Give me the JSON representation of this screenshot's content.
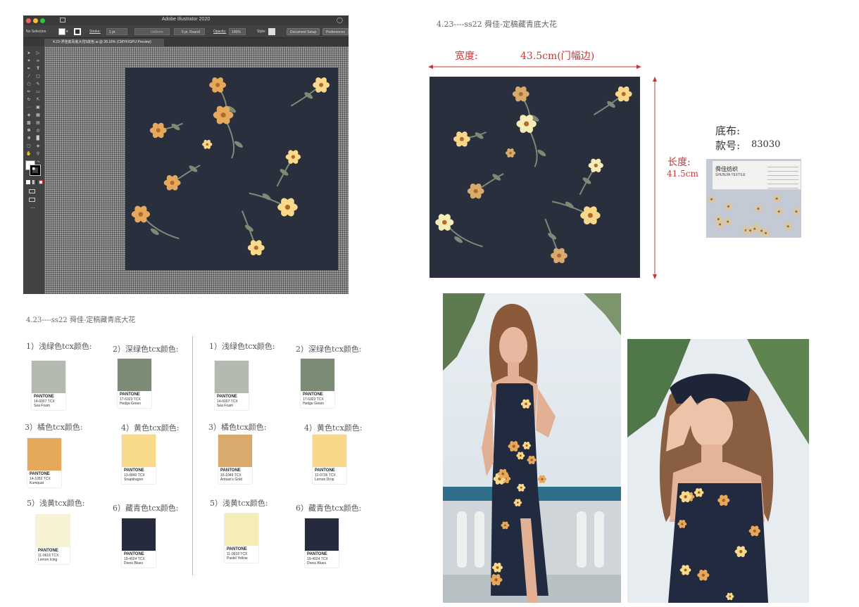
{
  "illustrator": {
    "app_title": "Adobe Illustrator 2020",
    "selection": "No Selection",
    "stroke_label": "Stroke:",
    "stroke_value": "1 pt",
    "uniform": "Uniform",
    "brush": "5 pt. Round",
    "opacity_label": "Opacity:",
    "opacity_value": "100%",
    "style_label": "Style:",
    "document_setup": "Document Setup",
    "preferences": "Preferences",
    "doc_tab": "4.23-浮佳底青底大花5底色.ai @ 28.18% (CMYK/GPU Preview)"
  },
  "header": {
    "title_right": "4.23----ss22 舜佳-定稿藏青底大花",
    "title_left": "4.23----ss22 舜佳-定稿藏青底大花"
  },
  "dimensions": {
    "width_label": "宽度:",
    "width_value": "43.5cm(门幅边)",
    "length_label": "长度:",
    "length_value": "41.5cm"
  },
  "fabric": {
    "base_label": "底布:",
    "code_label": "款号:",
    "code_value": "83030",
    "tag_brand": "舜佳纺织",
    "tag_brand_en": "SHUNJIA TEXTILE"
  },
  "palette_left": [
    {
      "label": "1）浅绿色tcx颜色:",
      "brand": "PANTONE",
      "code": "14-6007 TCX",
      "name": "Sea Foam",
      "color": "#b2b9af"
    },
    {
      "label": "2）深绿色tcx颜色:",
      "brand": "PANTONE",
      "code": "17-6323 TCX",
      "name": "Hedge Green",
      "color": "#7c8b76"
    },
    {
      "label": "3）橘色tcx颜色:",
      "brand": "PANTONE",
      "code": "14-1052 TCX",
      "name": "Kumquat",
      "color": "#e6a85a"
    },
    {
      "label": "4）黄色tcx颜色:",
      "brand": "PANTONE",
      "code": "13-0840 TCX",
      "name": "Snapdragon",
      "color": "#f9d98a"
    },
    {
      "label": "5）浅黄tcx颜色:",
      "brand": "PANTONE",
      "code": "11-0616 TCX",
      "name": "Lemon Icing",
      "color": "#f7f3d2"
    },
    {
      "label": "6）藏青色tcx颜色:",
      "brand": "PANTONE",
      "code": "19-4024 TCX",
      "name": "Dress Blues",
      "color": "#252b3d"
    }
  ],
  "palette_right": [
    {
      "label": "1）浅绿色tcx颜色:",
      "brand": "PANTONE",
      "code": "14-6007 TCX",
      "name": "Sea Foam",
      "color": "#b2b9af"
    },
    {
      "label": "2）深绿色tcx颜色:",
      "brand": "PANTONE",
      "code": "17-6323 TCX",
      "name": "Hedge Green",
      "color": "#7c8b76"
    },
    {
      "label": "3）橘色tcx颜色:",
      "brand": "PANTONE",
      "code": "15-1049 TCX",
      "name": "Artisan's Gold",
      "color": "#d8ab6c"
    },
    {
      "label": "4）黄色tcx颜色:",
      "brand": "PANTONE",
      "code": "12-0736 TCX",
      "name": "Lemon Drop",
      "color": "#f9d78a"
    },
    {
      "label": "5）浅黄tcx颜色:",
      "brand": "PANTONE",
      "code": "11-0618 TCX",
      "name": "Pastel Yellow",
      "color": "#f4edb8"
    },
    {
      "label": "6）藏青色tcx颜色:",
      "brand": "PANTONE",
      "code": "19-4024 TCX",
      "name": "Dress Blues",
      "color": "#252b3d"
    }
  ]
}
